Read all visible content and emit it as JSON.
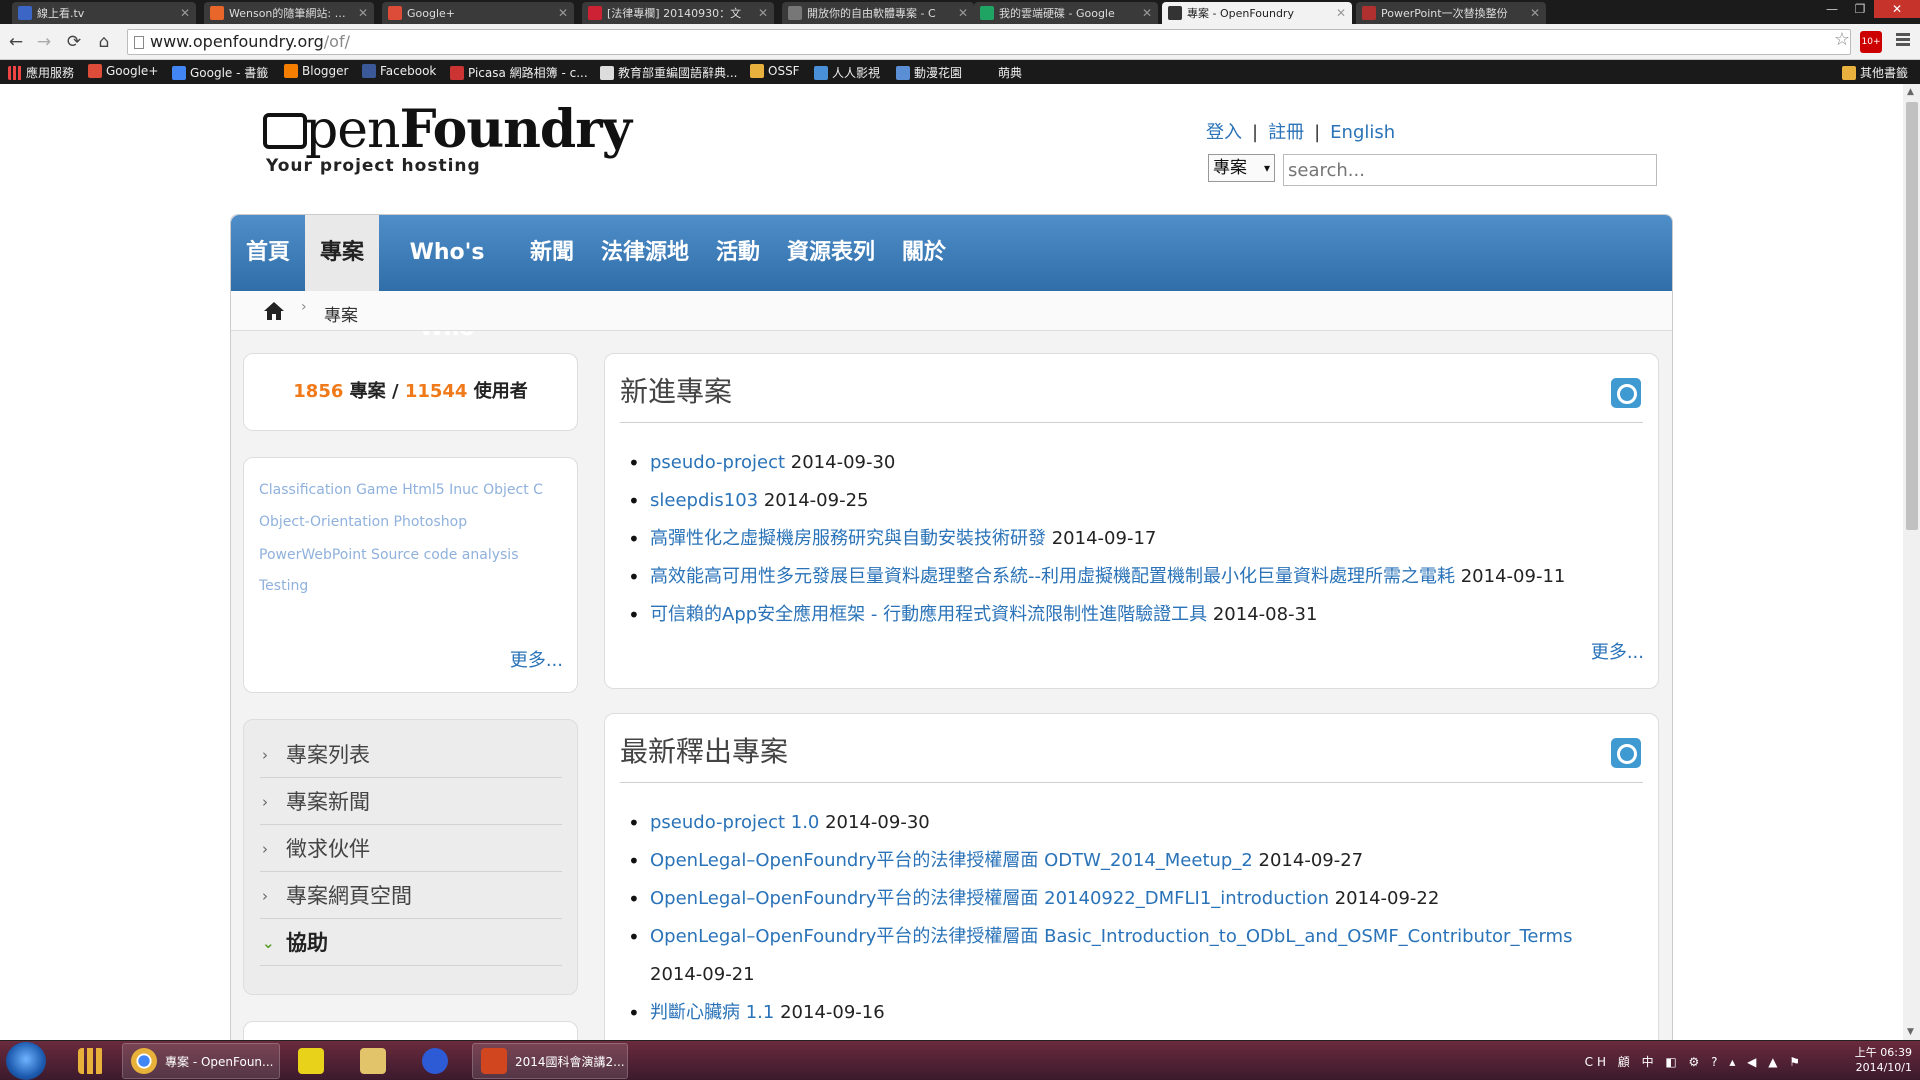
{
  "browser": {
    "tabs": [
      {
        "title": "線上看.tv",
        "color": "#3b66c6"
      },
      {
        "title": "Wenson的隨筆網站: 思想",
        "color": "#e8662a"
      },
      {
        "title": "Google+",
        "color": "#dd4b39"
      },
      {
        "title": "[法律專欄] 20140930：文",
        "color": "#c23"
      },
      {
        "title": "開放你的自由軟體專案 - C",
        "color": "#555"
      },
      {
        "title": "我的雲端硬碟 - Google",
        "color": "#1fa463"
      },
      {
        "title": "專案 - OpenFoundry",
        "color": "#333"
      },
      {
        "title": "PowerPoint一次替換整份",
        "color": "#b03030"
      }
    ],
    "window_controls": {
      "minimize": "—",
      "restore": "❐",
      "close": "✕"
    },
    "nav": {
      "back": "←",
      "forward": "→",
      "reload": "⟳",
      "home": "⌂"
    },
    "address": {
      "host": "www.openfoundry.org",
      "path": "/of/"
    },
    "extension_badge": "10+",
    "bookmarks": [
      {
        "label": "應用服務",
        "color": "#e44"
      },
      {
        "label": "Google+",
        "color": "#dd4b39"
      },
      {
        "label": "Google - 書籤",
        "color": "#4285f4"
      },
      {
        "label": "Blogger",
        "color": "#f57d00"
      },
      {
        "label": "Facebook",
        "color": "#3b5998"
      },
      {
        "label": "Picasa 網路相簿 - c...",
        "color": "#c33"
      },
      {
        "label": "教育部重編國語辭典...",
        "color": "#ddd"
      },
      {
        "label": "OSSF",
        "color": "#e8b03c"
      },
      {
        "label": "人人影視",
        "color": "#4a90d9"
      },
      {
        "label": "動漫花園",
        "color": "#5b8fd5"
      },
      {
        "label": "萌典",
        "color": "#1a1a1a"
      }
    ],
    "other_bookmarks": "其他書籤"
  },
  "site": {
    "logo": {
      "light": "pen",
      "bold": "Foundry",
      "tagline": "Your project hosting"
    },
    "toplinks": {
      "login": "登入",
      "register": "註冊",
      "english": "English",
      "sep": "|"
    },
    "search": {
      "scope": "專案",
      "placeholder": "search..."
    },
    "nav": [
      {
        "label": "首頁",
        "active": false
      },
      {
        "label": "專案",
        "active": true
      },
      {
        "label": "Who's Who",
        "active": false
      },
      {
        "label": "新聞",
        "active": false
      },
      {
        "label": "法律源地",
        "active": false
      },
      {
        "label": "活動",
        "active": false
      },
      {
        "label": "資源表列",
        "active": false
      },
      {
        "label": "關於",
        "active": false
      }
    ],
    "breadcrumb": {
      "current": "專案",
      "sep": "›"
    },
    "stats": {
      "projects": "1856",
      "projects_label": "專案",
      "divider": "/",
      "users": "11544",
      "users_label": "使用者"
    },
    "tags": {
      "lines": [
        "Classification  Game  Html5  Inuc  Object C",
        "Object-Orientation  Photoshop",
        "PowerWebPoint  Source code analysis",
        "Testing"
      ],
      "more": "更多..."
    },
    "sidemenu": [
      {
        "label": "專案列表",
        "arrow": "›",
        "open": false
      },
      {
        "label": "專案新聞",
        "arrow": "›",
        "open": false
      },
      {
        "label": "徵求伙伴",
        "arrow": "›",
        "open": false
      },
      {
        "label": "專案網頁空間",
        "arrow": "›",
        "open": false
      },
      {
        "label": "協助",
        "arrow": "⌄",
        "open": true
      }
    ],
    "new_projects": {
      "title": "新進專案",
      "items": [
        {
          "name": "pseudo-project",
          "date": "2014-09-30"
        },
        {
          "name": "sleepdis103",
          "date": "2014-09-25"
        },
        {
          "name": "高彈性化之虛擬機房服務研究與自動安裝技術研發",
          "date": "2014-09-17"
        },
        {
          "name": "高效能高可用性多元發展巨量資料處理整合系統--利用虛擬機配置機制最小化巨量資料處理所需之電耗",
          "date": "2014-09-11"
        },
        {
          "name": "可信賴的App安全應用框架 - 行動應用程式資料流限制性進階驗證工具",
          "date": "2014-08-31"
        }
      ],
      "more": "更多..."
    },
    "releases": {
      "title": "最新釋出專案",
      "items": [
        {
          "name": "pseudo-project 1.0",
          "date": "2014-09-30"
        },
        {
          "name": "OpenLegal–OpenFoundry平台的法律授權層面 ODTW_2014_Meetup_2",
          "date": "2014-09-27"
        },
        {
          "name": "OpenLegal–OpenFoundry平台的法律授權層面 20140922_DMFLI1_introduction",
          "date": "2014-09-22"
        },
        {
          "name": "OpenLegal–OpenFoundry平台的法律授權層面 Basic_Introduction_to_ODbL_and_OSMF_Contributor_Terms",
          "date": "2014-09-21"
        },
        {
          "name": "判斷心臟病 1.1",
          "date": "2014-09-16"
        }
      ]
    }
  },
  "taskbar": {
    "items": [
      {
        "label": "專案 - OpenFoun...",
        "color": "#e8b23a"
      },
      {
        "label": "",
        "color": "#e8d21a"
      },
      {
        "label": "",
        "color": "#e2c46a"
      },
      {
        "label": "",
        "color": "#2d5bd6"
      },
      {
        "label": "2014國科會演講2...",
        "color": "#d2461f"
      }
    ],
    "tray_icons": "CH 顧 中 ◧ ⚙ ? ▴ ◀ ▲ ⚑",
    "time": "上午 06:39",
    "date": "2014/10/1"
  }
}
